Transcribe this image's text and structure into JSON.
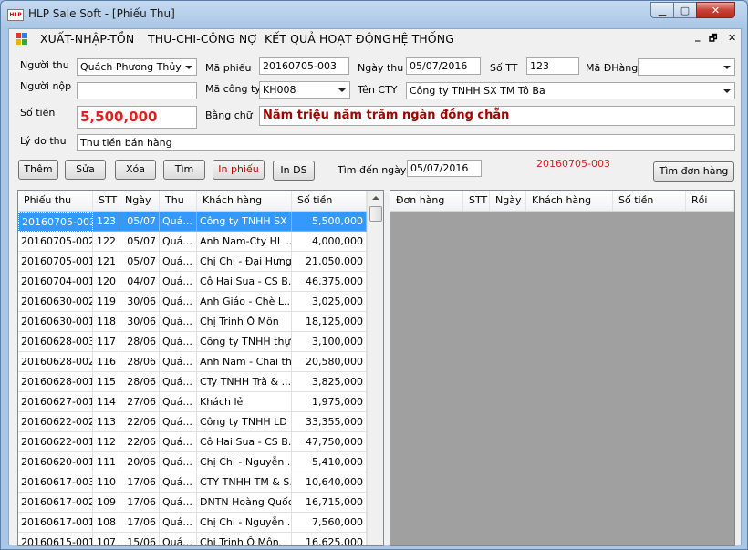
{
  "window": {
    "title": "HLP Sale Soft - [Phiếu Thu]",
    "icon_text": "HLP",
    "min_label": "▁",
    "max_label": "▢",
    "close_label": "✕"
  },
  "menu": {
    "items": [
      "XUẤT-NHẬP-TỒN",
      "THU-CHI-CÔNG NỢ",
      "KẾT QUẢ HOẠT ĐỘNG",
      "HỆ THỐNG"
    ],
    "mdi_min": "_",
    "mdi_restore": "🗗",
    "mdi_close": "✕"
  },
  "form": {
    "nguoi_thu_label": "Người thu",
    "nguoi_thu_value": "Quách Phương Thủy",
    "ma_phieu_label": "Mã phiếu",
    "ma_phieu_value": "20160705-003",
    "ngay_thu_label": "Ngày thu",
    "ngay_thu_value": "05/07/2016",
    "so_tt_label": "Số TT",
    "so_tt_value": "123",
    "ma_dhang_label": "Mã ĐHàng",
    "ma_dhang_value": "",
    "nguoi_nop_label": "Người nộp",
    "nguoi_nop_value": "",
    "ma_cong_ty_label": "Mã công ty",
    "ma_cong_ty_value": "KH008",
    "ten_cty_label": "Tên CTY",
    "ten_cty_value": "Công ty TNHH SX TM Tô Ba",
    "so_tien_label": "Số tiền",
    "so_tien_value": "5,500,000",
    "bang_chu_label": "Bằng chữ",
    "bang_chu_value": "Năm triệu năm trăm ngàn đồng chẵn",
    "ly_do_label": "Lý do thu",
    "ly_do_value": "Thu tiền bán hàng"
  },
  "toolbar": {
    "them": "Thêm",
    "sua": "Sửa",
    "xoa": "Xóa",
    "tim": "Tìm",
    "in_phieu": "In phiếu",
    "in_ds": "In DS",
    "tim_den_ngay_label": "Tìm đến ngày",
    "tim_den_ngay_value": "05/07/2016",
    "current_code": "20160705-003",
    "tim_don_hang": "Tìm đơn hàng"
  },
  "receipts": {
    "columns": [
      "Phiếu thu",
      "STT",
      "Ngày",
      "Thu",
      "Khách hàng",
      "Số tiền"
    ],
    "rows": [
      [
        "20160705-003",
        "123",
        "05/07",
        "Quá...",
        "Công ty TNHH SX ...",
        "5,500,000"
      ],
      [
        "20160705-002",
        "122",
        "05/07",
        "Quá...",
        "Anh Nam-Cty HL ...",
        "4,000,000"
      ],
      [
        "20160705-001",
        "121",
        "05/07",
        "Quá...",
        "Chị Chi - Đại Hưng",
        "21,050,000"
      ],
      [
        "20160704-001",
        "120",
        "04/07",
        "Quá...",
        "Cô Hai Sua - CS B...",
        "46,375,000"
      ],
      [
        "20160630-002",
        "119",
        "30/06",
        "Quá...",
        "Anh Giáo - Chè L...",
        "3,025,000"
      ],
      [
        "20160630-001",
        "118",
        "30/06",
        "Quá...",
        "Chị Trinh Ô Môn",
        "18,125,000"
      ],
      [
        "20160628-003",
        "117",
        "28/06",
        "Quá...",
        "Công ty TNHH thự...",
        "3,100,000"
      ],
      [
        "20160628-002",
        "116",
        "28/06",
        "Quá...",
        "Anh Nam - Chai th...",
        "20,580,000"
      ],
      [
        "20160628-001",
        "115",
        "28/06",
        "Quá...",
        "CTy TNHH Trà & ...",
        "3,825,000"
      ],
      [
        "20160627-001",
        "114",
        "27/06",
        "Quá...",
        "Khách lẻ",
        "1,975,000"
      ],
      [
        "20160622-002",
        "113",
        "22/06",
        "Quá...",
        "Công ty TNHH LD ...",
        "33,355,000"
      ],
      [
        "20160622-001",
        "112",
        "22/06",
        "Quá...",
        "Cô Hai Sua - CS B...",
        "47,750,000"
      ],
      [
        "20160620-001",
        "111",
        "20/06",
        "Quá...",
        "Chị Chi - Nguyễn ...",
        "5,410,000"
      ],
      [
        "20160617-003",
        "110",
        "17/06",
        "Quá...",
        "CTY TNHH TM & S...",
        "10,640,000"
      ],
      [
        "20160617-002",
        "109",
        "17/06",
        "Quá...",
        "DNTN Hoàng Quốc",
        "16,715,000"
      ],
      [
        "20160617-001",
        "108",
        "17/06",
        "Quá...",
        "Chị Chi - Nguyễn ...",
        "7,560,000"
      ],
      [
        "20160615-001",
        "107",
        "15/06",
        "Quá...",
        "Chị Trinh Ô Môn",
        "16,625,000"
      ]
    ]
  },
  "orders": {
    "columns": [
      "Đơn hàng",
      "STT",
      "Ngày",
      "Khách hàng",
      "Số tiền",
      "Rồi"
    ]
  }
}
